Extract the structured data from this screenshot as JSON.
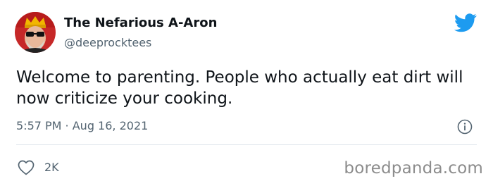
{
  "author": {
    "display_name": "The Nefarious A-Aron",
    "handle": "@deeprocktees",
    "avatar_icon": "avatar-photo"
  },
  "tweet": {
    "text": "Welcome to parenting. People who actually eat dirt will now criticize your cooking.",
    "timestamp": "5:57 PM · Aug 16, 2021"
  },
  "actions": {
    "like_count": "2K",
    "like_icon": "heart-icon",
    "info_icon": "info-icon"
  },
  "branding": {
    "logo_icon": "twitter-bird-icon",
    "logo_color": "#1d9bf0",
    "watermark": "boredpanda.com"
  },
  "colors": {
    "text_primary": "#0f1419",
    "text_secondary": "#536471",
    "divider": "#e1e8ed"
  }
}
